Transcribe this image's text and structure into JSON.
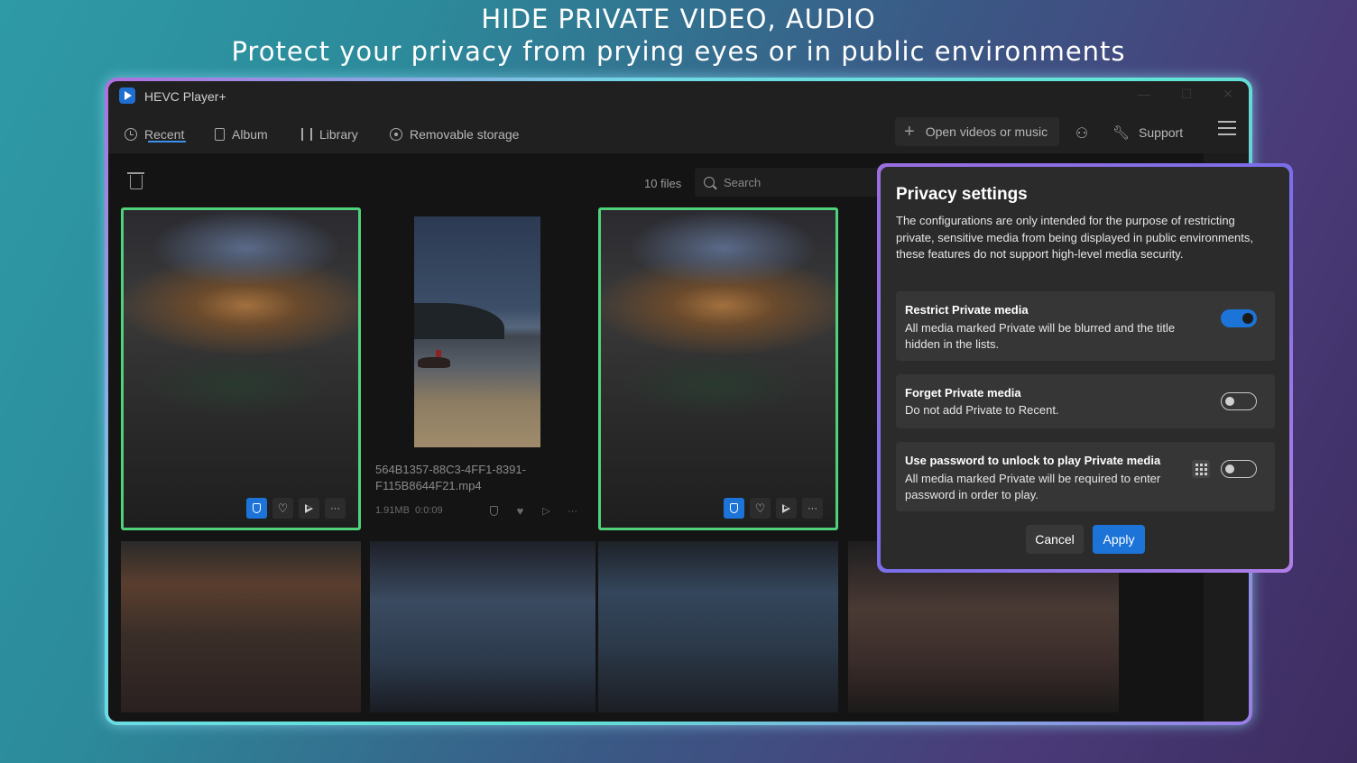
{
  "promo": {
    "title": "HIDE PRIVATE VIDEO, AUDIO",
    "subtitle": "Protect your privacy from prying eyes or in public environments"
  },
  "window": {
    "app_title": "HEVC Player+",
    "controls": [
      "—",
      "☐",
      "✕"
    ]
  },
  "nav": {
    "items": [
      {
        "label": "Recent",
        "icon": "clock-icon",
        "active": true
      },
      {
        "label": "Album",
        "icon": "album-icon"
      },
      {
        "label": "Library",
        "icon": "library-icon"
      },
      {
        "label": "Removable storage",
        "icon": "disk-icon"
      }
    ],
    "open_button": "Open videos or music",
    "support": "Support"
  },
  "toolbar": {
    "file_count": "10 files",
    "search_placeholder": "Search"
  },
  "files": {
    "visible_file_name": "564B1357-88C3-4FF1-8391-F115B8644F21.mp4",
    "visible_file_size": "1.91MB",
    "visible_file_duration": "0:0:09"
  },
  "privacy_modal": {
    "title": "Privacy settings",
    "description": "The configurations are only intended for the purpose of restricting private, sensitive media from being displayed in public environments, these features do not support high-level media security.",
    "settings": [
      {
        "title": "Restrict Private media",
        "description": "All media marked Private will be blurred and the title hidden in the lists.",
        "enabled": true
      },
      {
        "title": "Forget Private media",
        "description": "Do not add Private to Recent.",
        "enabled": false
      },
      {
        "title": "Use password to unlock to play Private media",
        "description": "All media marked Private will be required to enter password in order to play.",
        "enabled": false
      }
    ],
    "cancel_label": "Cancel",
    "apply_label": "Apply"
  },
  "colors": {
    "accent": "#1d74d8",
    "selection": "#4fd27a",
    "window_bg": "#202020"
  }
}
